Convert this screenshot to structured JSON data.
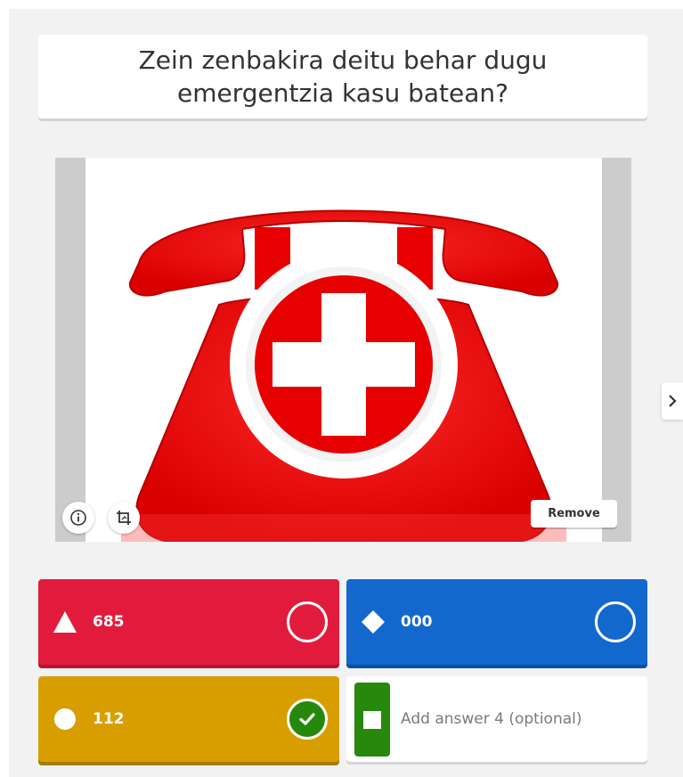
{
  "question": {
    "text": "Zein zenbakira deitu behar dugu emergentzia kasu batean?"
  },
  "media": {
    "icon": "emergency-phone-cross-image",
    "remove_label": "Remove"
  },
  "icons": {
    "info": "info-icon",
    "crop": "crop-icon",
    "next": "chevron-right-icon"
  },
  "answers": [
    {
      "shape": "triangle-icon",
      "text": "685",
      "color": "#e21b3c",
      "correct": false
    },
    {
      "shape": "diamond-icon",
      "text": "000",
      "color": "#1368ce",
      "correct": false
    },
    {
      "shape": "circle-icon",
      "text": "112",
      "color": "#d89e00",
      "correct": true
    },
    {
      "shape": "square-icon",
      "text": "",
      "placeholder": "Add answer 4 (optional)",
      "color": "#26890c",
      "correct": false
    }
  ]
}
